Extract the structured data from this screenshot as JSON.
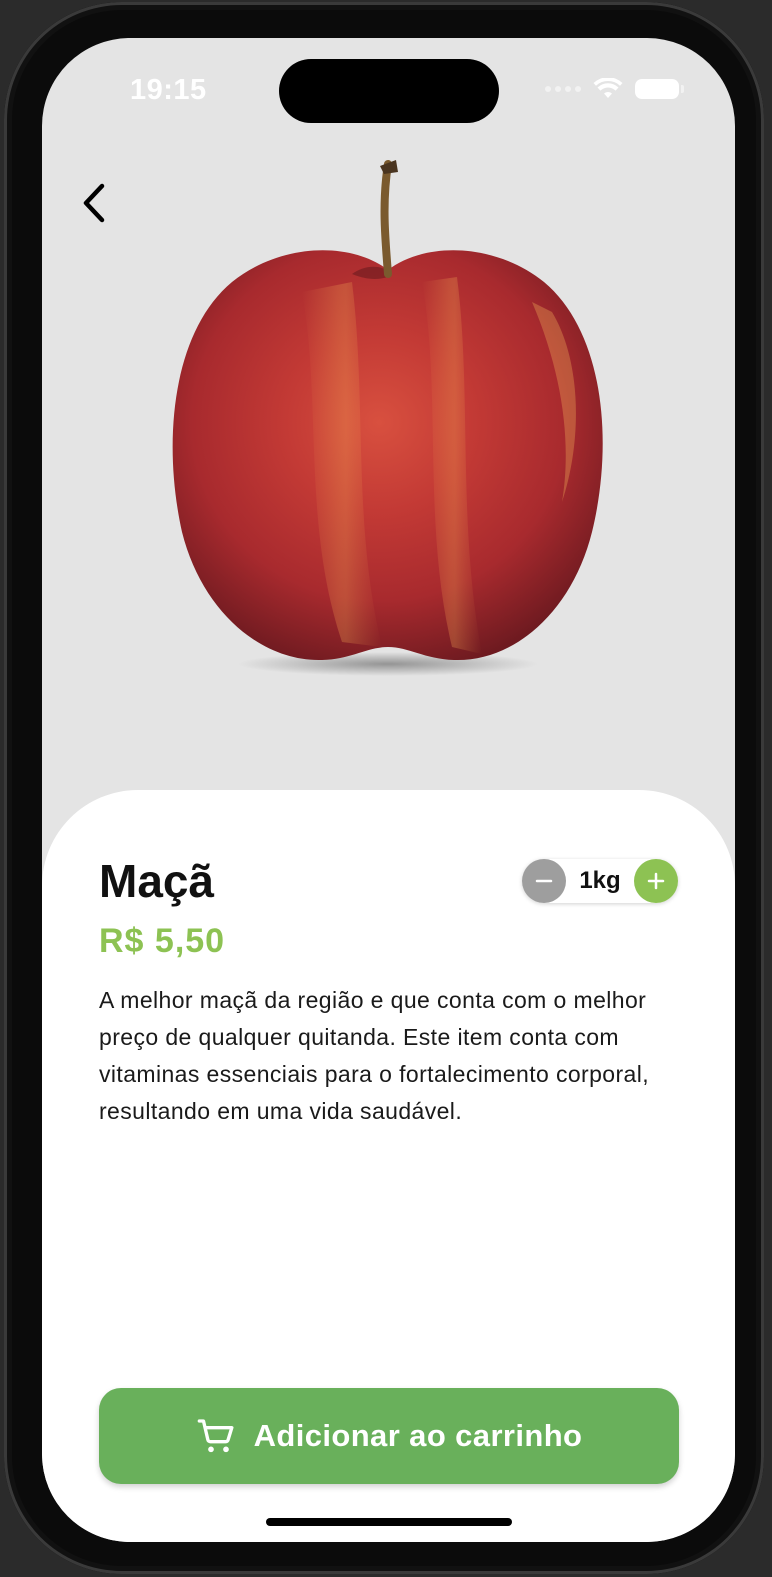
{
  "status_bar": {
    "time": "19:15"
  },
  "navigation": {
    "back_icon": "chevron-left-icon"
  },
  "product": {
    "name": "Maçã",
    "price": "R$ 5,50",
    "quantity": "1kg",
    "description": "A melhor maçã da região e que conta com o melhor preço de qualquer quitanda. Este item conta com vitaminas essenciais para o fortalecimento corporal, resultando em uma vida saudável.",
    "image_icon": "red-apple-photo"
  },
  "actions": {
    "add_to_cart_label": "Adicionar ao carrinho",
    "cart_icon": "shopping-cart-icon"
  },
  "colors": {
    "accent_green": "#8dc253",
    "button_green": "#69b05b",
    "minus_grey": "#9e9e9e",
    "image_background": "#e4e4e4"
  }
}
